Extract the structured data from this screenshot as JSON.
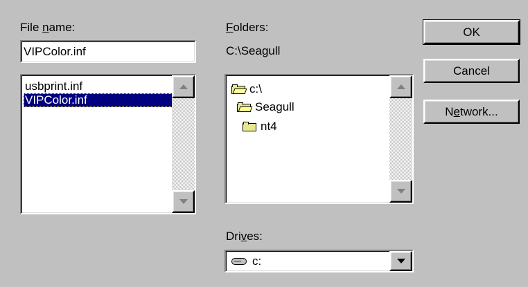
{
  "file_name": {
    "label_prefix": "File ",
    "label_mnemonic": "n",
    "label_suffix": "ame:",
    "value": "VIPColor.inf",
    "files": [
      "usbprint.inf",
      "VIPColor.inf"
    ],
    "selected_index": 1
  },
  "folders": {
    "label_mnemonic": "F",
    "label_suffix": "olders:",
    "current_path": "C:\\Seagull",
    "tree": [
      {
        "name": "c:\\",
        "icon": "open-folder-icon"
      },
      {
        "name": "Seagull",
        "icon": "open-folder-icon"
      },
      {
        "name": "nt4",
        "icon": "folder-icon"
      }
    ]
  },
  "drives": {
    "label_prefix": "Dri",
    "label_mnemonic": "v",
    "label_suffix": "es:",
    "selected": "c:",
    "icon": "hard-drive-icon"
  },
  "buttons": {
    "ok": "OK",
    "cancel": "Cancel",
    "network_prefix": "N",
    "network_mnemonic": "e",
    "network_suffix": "twork..."
  },
  "colors": {
    "face": "#c0c0c0",
    "selection": "#000080"
  }
}
